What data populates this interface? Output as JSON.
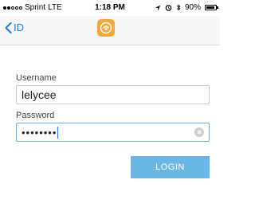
{
  "status_bar": {
    "carrier": "Sprint",
    "network": "LTE",
    "time": "1:18 PM",
    "battery": "90%",
    "battery_level": 0.9
  },
  "nav": {
    "back_label": "ID",
    "accent_color": "#1e7ae6",
    "logo_color": "#f2a83a"
  },
  "form": {
    "username_label": "Username",
    "username_value": "lelycee",
    "password_label": "Password",
    "password_value": "••••••••"
  },
  "login_button": {
    "label": "LOGIN",
    "color": "#6ab7e3"
  }
}
